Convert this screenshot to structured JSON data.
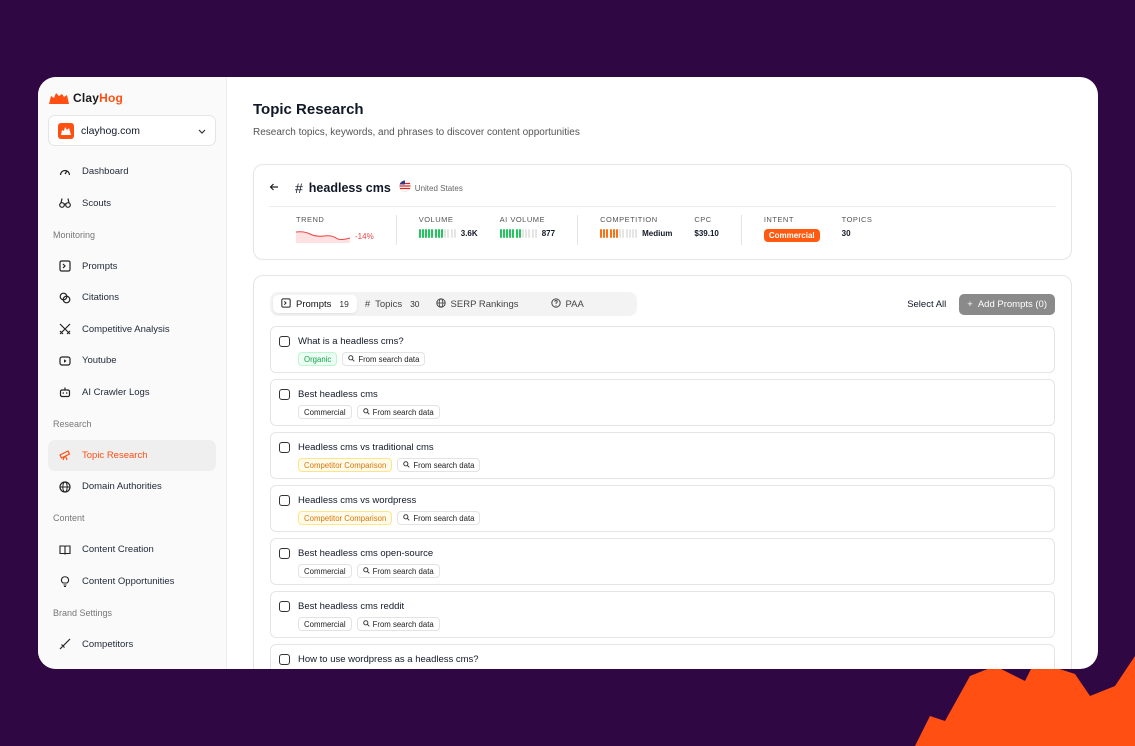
{
  "brand": {
    "name_a": "Clay",
    "name_b": "Hog",
    "accent": "#ff4f12",
    "bg": "#2f0742"
  },
  "site_select": {
    "value": "clayhog.com"
  },
  "nav": {
    "dashboard": "Dashboard",
    "scouts": "Scouts",
    "section_monitoring": "Monitoring",
    "prompts": "Prompts",
    "citations": "Citations",
    "competitive": "Competitive Analysis",
    "youtube": "Youtube",
    "crawler": "AI Crawler Logs",
    "section_research": "Research",
    "topic_research": "Topic Research",
    "domain_authorities": "Domain Authorities",
    "section_content": "Content",
    "content_creation": "Content Creation",
    "content_opportunities": "Content Opportunities",
    "section_brand": "Brand Settings",
    "competitors": "Competitors"
  },
  "page": {
    "title": "Topic Research",
    "subtitle": "Research topics, keywords, and phrases to discover content opportunities"
  },
  "summary": {
    "keyword": "headless cms",
    "country": "United States",
    "trend_label": "TREND",
    "trend_value": "-14%",
    "volume_label": "VOLUME",
    "volume_value": "3.6K",
    "volume_level": 0.7,
    "ai_volume_label": "AI VOLUME",
    "ai_volume_value": "877",
    "ai_volume_level": 0.6,
    "competition_label": "COMPETITION",
    "competition_value": "Medium",
    "competition_level": 0.5,
    "cpc_label": "CPC",
    "cpc_value": "$39.10",
    "intent_label": "INTENT",
    "intent_value": "Commercial",
    "topics_label": "TOPICS",
    "topics_value": "30"
  },
  "tabs": {
    "prompts": "Prompts",
    "prompts_count": "19",
    "topics": "Topics",
    "topics_count": "30",
    "serp": "SERP Rankings",
    "paa": "PAA"
  },
  "actions": {
    "select_all": "Select All",
    "add_prompts": "Add Prompts (0)"
  },
  "rows": [
    {
      "title": "What is a headless cms?",
      "tag": "Organic",
      "source": "From search data"
    },
    {
      "title": "Best headless cms",
      "tag": "Commercial",
      "source": "From search data"
    },
    {
      "title": "Headless cms vs traditional cms",
      "tag": "Competitor Comparison",
      "source": "From search data"
    },
    {
      "title": "Headless cms vs wordpress",
      "tag": "Competitor Comparison",
      "source": "From search data"
    },
    {
      "title": "Best headless cms open-source",
      "tag": "Commercial",
      "source": "From search data"
    },
    {
      "title": "Best headless cms reddit",
      "tag": "Commercial",
      "source": "From search data"
    },
    {
      "title": "How to use wordpress as a headless cms?",
      "tag": "",
      "source": ""
    }
  ]
}
